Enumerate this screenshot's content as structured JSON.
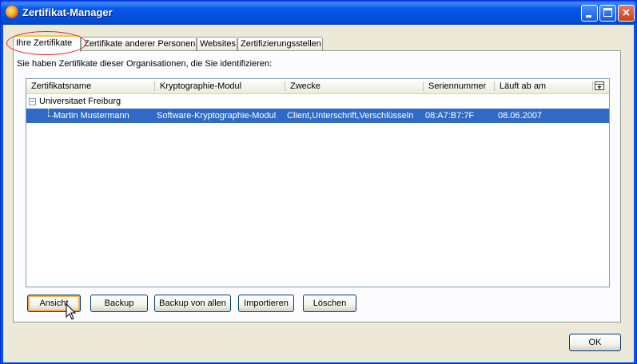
{
  "window": {
    "title": "Zertifikat-Manager",
    "icon": "firefox-icon",
    "controls": {
      "minimize": "minimize-icon",
      "maximize": "maximize-icon",
      "close": "×"
    }
  },
  "tabs": [
    {
      "label": "Ihre Zertifikate",
      "active": true
    },
    {
      "label": "Zertifikate anderer Personen",
      "active": false
    },
    {
      "label": "Websites",
      "active": false
    },
    {
      "label": "Zertifizierungsstellen",
      "active": false
    }
  ],
  "intro_text": "Sie haben Zertifikate dieser Organisationen, die Sie identifizieren:",
  "table": {
    "columns": [
      "Zertifikatsname",
      "Kryptographie-Modul",
      "Zwecke",
      "Seriennummer",
      "Läuft ab am"
    ],
    "column_picker_icon": "column-picker-icon",
    "group": {
      "label": "Universitaet Freiburg",
      "expanded": true,
      "twisty": "−"
    },
    "rows": [
      {
        "name": "Martin Mustermann",
        "module": "Software-Kryptographie-Modul",
        "purposes": "Client,Unterschrift,Verschlüsseln",
        "serial": "08:A7:B7:7F",
        "expires": "08.06.2007",
        "selected": true
      }
    ]
  },
  "buttons": {
    "view": "Ansicht",
    "backup": "Backup",
    "backup_all": "Backup von allen",
    "import": "Importieren",
    "delete": "Löschen",
    "ok": "OK"
  },
  "colors": {
    "titlebar": "#0054e3",
    "selection": "#316ac5",
    "tab_highlight": "#e22b2b",
    "active_tab_accent": "#ffc83c"
  }
}
